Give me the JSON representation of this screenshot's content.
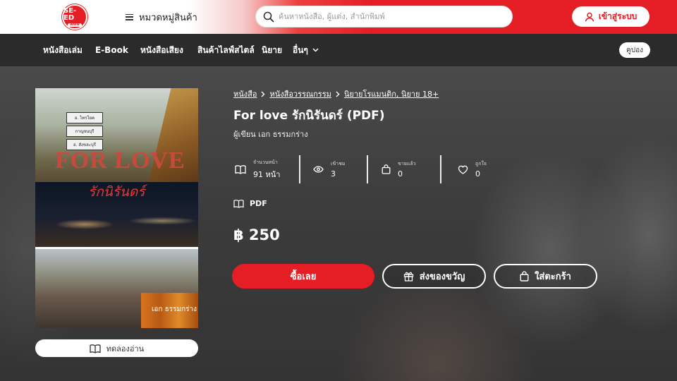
{
  "header": {
    "logo_text": "SE-ED",
    "logo_sub": "www",
    "categories_label": "หมวดหมู่สินค้า",
    "search_placeholder": "ค้นหาหนังสือ, ผู้แต่ง, สำนักพิมพ์",
    "login_label": "เข้าสู่ระบบ"
  },
  "nav": {
    "items": [
      {
        "label": "หนังสือเล่ม"
      },
      {
        "label": "E-Book"
      },
      {
        "label": "หนังสือเสียง"
      },
      {
        "label": "สินค้าไลฟ์สไตล์"
      },
      {
        "label": "นิยาย"
      },
      {
        "label": "อื่นๆ"
      }
    ],
    "coupon_label": "คูปอง"
  },
  "cover": {
    "art_title": "FOR LOVE",
    "art_thai_title": "รักนิรันดร์",
    "art_author": "เอก ธรรมกร่าง",
    "art_signs": [
      "อ. ไทรโยค",
      "กาญจนบุรี",
      "อ. สังขละบุรี"
    ]
  },
  "try_read_label": "ทดลองอ่าน",
  "breadcrumb": [
    "หนังสือ",
    "หนังสือวรรณกรรม",
    "นิยายโรแมนติก, นิยาย 18+"
  ],
  "book": {
    "title": "For love รักนิรันดร์ (PDF)",
    "author_line": "ผู้เขียน เอก ธรรมกร่าง",
    "format": "PDF",
    "price": "฿ 250"
  },
  "stats": [
    {
      "label": "จำนวนหน้า",
      "value": "91 หน้า",
      "icon": "book-open-icon"
    },
    {
      "label": "เข้าชม",
      "value": "3",
      "icon": "eye-icon"
    },
    {
      "label": "ขายแล้ว",
      "value": "0",
      "icon": "bag-icon"
    },
    {
      "label": "ถูกใจ",
      "value": "0",
      "icon": "heart-icon"
    }
  ],
  "actions": {
    "buy_label": "ซื้อเลย",
    "gift_label": "ส่งของขวัญ",
    "cart_label": "ใส่ตะกร้า"
  },
  "colors": {
    "brand_red": "#e41e24",
    "nav_bg": "#2b2b2b"
  }
}
